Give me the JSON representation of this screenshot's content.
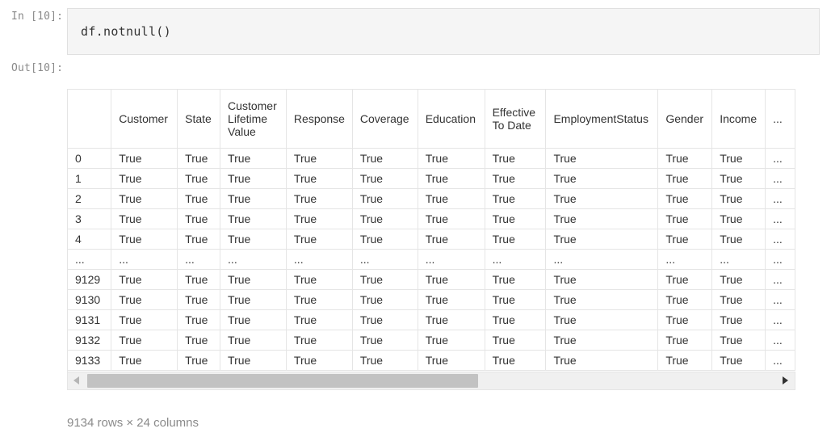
{
  "input_prompt": "In [10]:",
  "output_prompt": "Out[10]:",
  "code": "df.notnull()",
  "table": {
    "columns": [
      "",
      "Customer",
      "State",
      "Customer Lifetime Value",
      "Response",
      "Coverage",
      "Education",
      "Effective To Date",
      "EmploymentStatus",
      "Gender",
      "Income",
      "..."
    ],
    "rows": [
      [
        "0",
        "True",
        "True",
        "True",
        "True",
        "True",
        "True",
        "True",
        "True",
        "True",
        "True",
        "..."
      ],
      [
        "1",
        "True",
        "True",
        "True",
        "True",
        "True",
        "True",
        "True",
        "True",
        "True",
        "True",
        "..."
      ],
      [
        "2",
        "True",
        "True",
        "True",
        "True",
        "True",
        "True",
        "True",
        "True",
        "True",
        "True",
        "..."
      ],
      [
        "3",
        "True",
        "True",
        "True",
        "True",
        "True",
        "True",
        "True",
        "True",
        "True",
        "True",
        "..."
      ],
      [
        "4",
        "True",
        "True",
        "True",
        "True",
        "True",
        "True",
        "True",
        "True",
        "True",
        "True",
        "..."
      ],
      [
        "...",
        "...",
        "...",
        "...",
        "...",
        "...",
        "...",
        "...",
        "...",
        "...",
        "...",
        "..."
      ],
      [
        "9129",
        "True",
        "True",
        "True",
        "True",
        "True",
        "True",
        "True",
        "True",
        "True",
        "True",
        "..."
      ],
      [
        "9130",
        "True",
        "True",
        "True",
        "True",
        "True",
        "True",
        "True",
        "True",
        "True",
        "True",
        "..."
      ],
      [
        "9131",
        "True",
        "True",
        "True",
        "True",
        "True",
        "True",
        "True",
        "True",
        "True",
        "True",
        "..."
      ],
      [
        "9132",
        "True",
        "True",
        "True",
        "True",
        "True",
        "True",
        "True",
        "True",
        "True",
        "True",
        "..."
      ],
      [
        "9133",
        "True",
        "True",
        "True",
        "True",
        "True",
        "True",
        "True",
        "True",
        "True",
        "True",
        "..."
      ]
    ]
  },
  "summary": "9134 rows × 24 columns",
  "icons": {
    "scroll_left": "scroll-left-arrow-icon",
    "scroll_right": "scroll-right-arrow-icon"
  }
}
